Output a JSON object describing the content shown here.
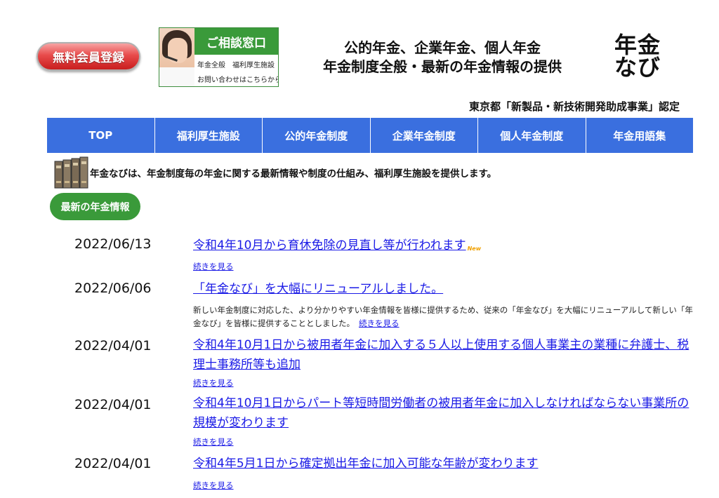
{
  "header": {
    "signup_label": "無料会員登録",
    "consult_title": "ご相談窓口",
    "consult_line1": "年金全般　福利厚生施設",
    "consult_line2": "お問い合わせはこちらから",
    "headline_line1": "公的年金、企業年金、個人年金",
    "headline_line2": "年金制度全般・最新の年金情報の提供",
    "logo_line1": "年金",
    "logo_line2": "なび",
    "certified": "東京都「新製品・新技術開発助成事業」認定"
  },
  "nav": {
    "items": [
      {
        "label": "TOP"
      },
      {
        "label": "福利厚生施設"
      },
      {
        "label": "公的年金制度"
      },
      {
        "label": "企業年金制度"
      },
      {
        "label": "個人年金制度"
      },
      {
        "label": "年金用語集"
      }
    ],
    "color": "#3a6fdf"
  },
  "intro": {
    "text": "年金なびは、年金制度毎の年金に関する最新情報や制度の仕組み、福利厚生施設を提供します。",
    "badge": "最新の年金情報"
  },
  "news": {
    "more_label": "続きを見る",
    "new_label": "New",
    "items": [
      {
        "date": "2022/06/13",
        "title": "令和4年10月から育休免除の見直し等が行われます",
        "is_new": true
      },
      {
        "date": "2022/06/06",
        "title": "「年金なび」を大幅にリニューアルしました。",
        "description": "新しい年金制度に対応した、より分かりやすい年金情報を皆様に提供するため、従来の「年金なび」を大幅にリニューアルして新しい「年金なび」を皆様に提供することとしました。"
      },
      {
        "date": "2022/04/01",
        "title": "令和4年10月1日から被用者年金に加入する５人以上使用する個人事業主の業種に弁護士、税理士事務所等も追加"
      },
      {
        "date": "2022/04/01",
        "title": "令和4年10月1日からパート等短時間労働者の被用者年金に加入しなければならない事業所の規模が変わります"
      },
      {
        "date": "2022/04/01",
        "title": "令和4年5月1日から確定拠出年金に加入可能な年齢が変わります"
      }
    ]
  },
  "colors": {
    "link": "#1a1ae6",
    "green": "#3a9a3a",
    "signup_red": "#e84b4b"
  }
}
